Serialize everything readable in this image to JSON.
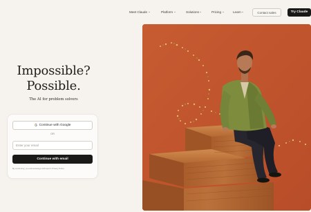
{
  "nav": {
    "items": [
      {
        "label": "Meet Claude",
        "dropdown": true
      },
      {
        "label": "Platform",
        "dropdown": true
      },
      {
        "label": "Solutions",
        "dropdown": true
      },
      {
        "label": "Pricing",
        "dropdown": true
      },
      {
        "label": "Learn",
        "dropdown": true
      }
    ],
    "contact_label": "Contact sales",
    "try_label": "Try Claude"
  },
  "hero": {
    "title_line1": "Impossible?",
    "title_line2": "Possible.",
    "subtitle": "The AI for problem solvers"
  },
  "signup": {
    "google_label": "Continue with Google",
    "divider": "OR",
    "email_placeholder": "Enter your email",
    "email_value": "",
    "email_button_label": "Continue with email",
    "legal": "By continuing, you acknowledge Anthropic's Privacy Policy"
  },
  "colors": {
    "background": "#f6f3ee",
    "primary_button": "#1a1917",
    "hero_backdrop": "#c2552e",
    "wood": "#b66a33"
  },
  "icons": {
    "google": "google-g-icon",
    "dropdown": "chevron-down-icon"
  }
}
